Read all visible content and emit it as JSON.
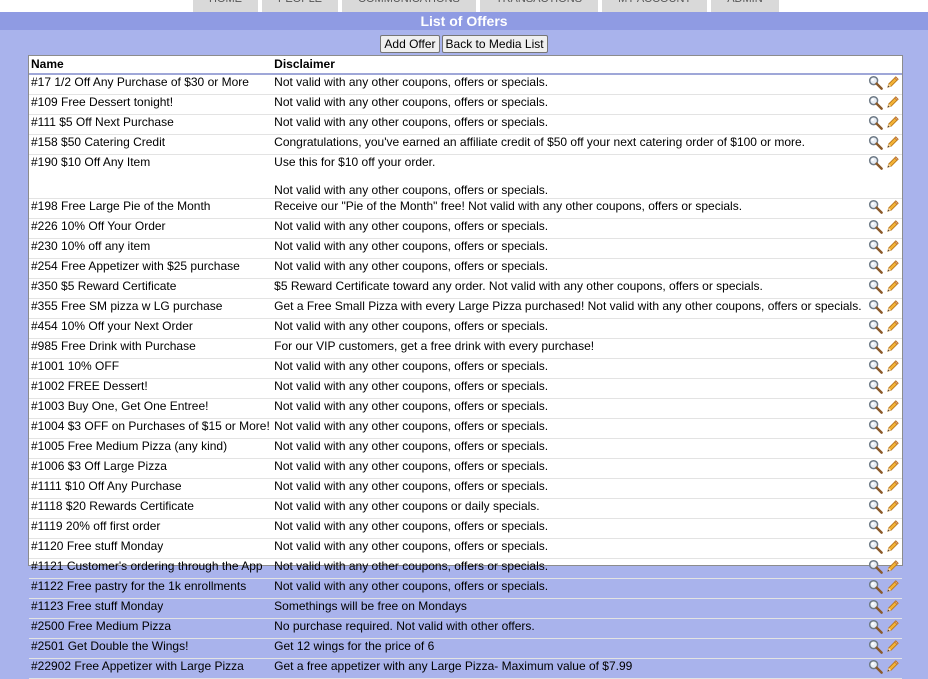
{
  "nav": {
    "tabs": [
      "HOME",
      "PEOPLE",
      "COMMUNICATIONS",
      "TRANSACTIONS",
      "MY ACCOUNT",
      "ADMIN"
    ]
  },
  "page": {
    "title": "List of Offers"
  },
  "toolbar": {
    "add_offer_label": "Add Offer",
    "back_label": "Back to Media List"
  },
  "table": {
    "headers": {
      "name": "Name",
      "disclaimer": "Disclaimer"
    },
    "rows": [
      {
        "name": "#17 1/2 Off Any Purchase of $30 or More",
        "disclaimer": "Not valid with any other coupons, offers or specials."
      },
      {
        "name": "#109 Free Dessert tonight!",
        "disclaimer": "Not valid with any other coupons, offers or specials."
      },
      {
        "name": "#111 $5 Off Next Purchase",
        "disclaimer": "Not valid with any other coupons, offers or specials."
      },
      {
        "name": "#158 $50 Catering Credit",
        "disclaimer": "Congratulations, you've earned an affiliate credit of $50 off your next catering order of $100 or more."
      },
      {
        "name": "#190 $10 Off Any Item",
        "disclaimer": "Use this for $10 off your order.",
        "disclaimer_note": "Not valid with any other coupons, offers or specials."
      },
      {
        "name": "#198 Free Large Pie of the Month",
        "disclaimer": "Receive our \"Pie of the Month\" free! Not valid with any other coupons, offers or specials."
      },
      {
        "name": "#226 10% Off Your Order",
        "disclaimer": "Not valid with any other coupons, offers or specials."
      },
      {
        "name": "#230 10% off any item",
        "disclaimer": "Not valid with any other coupons, offers or specials."
      },
      {
        "name": "#254 Free Appetizer with $25 purchase",
        "disclaimer": "Not valid with any other coupons, offers or specials."
      },
      {
        "name": "#350 $5 Reward Certificate",
        "disclaimer": "$5 Reward Certificate toward any order. Not valid with any other coupons, offers or specials."
      },
      {
        "name": "#355 Free SM pizza w LG purchase",
        "disclaimer": "Get a Free Small Pizza with every Large Pizza purchased! Not valid with any other coupons, offers or specials."
      },
      {
        "name": "#454 10% Off your Next Order",
        "disclaimer": "Not valid with any other coupons, offers or specials."
      },
      {
        "name": "#985 Free Drink with Purchase",
        "disclaimer": "For our VIP customers, get a free drink with every purchase!"
      },
      {
        "name": "#1001 10% OFF",
        "disclaimer": "Not valid with any other coupons, offers or specials."
      },
      {
        "name": "#1002 FREE Dessert!",
        "disclaimer": "Not valid with any other coupons, offers or specials."
      },
      {
        "name": "#1003 Buy One, Get One Entree!",
        "disclaimer": "Not valid with any other coupons, offers or specials."
      },
      {
        "name": "#1004 $3 OFF on Purchases of $15 or More!",
        "disclaimer": "Not valid with any other coupons, offers or specials."
      },
      {
        "name": "#1005 Free Medium Pizza (any kind)",
        "disclaimer": "Not valid with any other coupons, offers or specials."
      },
      {
        "name": "#1006 $3 Off Large Pizza",
        "disclaimer": "Not valid with any other coupons, offers or specials."
      },
      {
        "name": "#1111 $10 Off Any Purchase",
        "disclaimer": "Not valid with any other coupons, offers or specials."
      },
      {
        "name": "#1118 $20 Rewards Certificate",
        "disclaimer": "Not valid with any other coupons or daily specials."
      },
      {
        "name": "#1119 20% off first order",
        "disclaimer": "Not valid with any other coupons, offers or specials."
      },
      {
        "name": "#1120 Free stuff Monday",
        "disclaimer": "Not valid with any other coupons, offers or specials."
      },
      {
        "name": "#1121 Customer's ordering through the App",
        "disclaimer": "Not valid with any other coupons, offers or specials."
      },
      {
        "name": "#1122 Free pastry for the 1k enrollments",
        "disclaimer": "Not valid with any other coupons, offers or specials."
      },
      {
        "name": "#1123 Free stuff Monday",
        "disclaimer": "Somethings will be free on Mondays"
      },
      {
        "name": "#2500 Free Medium Pizza",
        "disclaimer": "No purchase required. Not valid with other offers."
      },
      {
        "name": "#2501 Get Double the Wings!",
        "disclaimer": "Get 12 wings for the price of 6"
      },
      {
        "name": "#22902 Free Appetizer with Large Pizza",
        "disclaimer": "Get a free appetizer with any Large Pizza- Maximum value of $7.99"
      }
    ]
  },
  "icons": {
    "view": "magnifier-icon",
    "edit": "pencil-icon"
  },
  "colors": {
    "background": "#a9b3ec",
    "titlebar": "#8f9be3"
  }
}
